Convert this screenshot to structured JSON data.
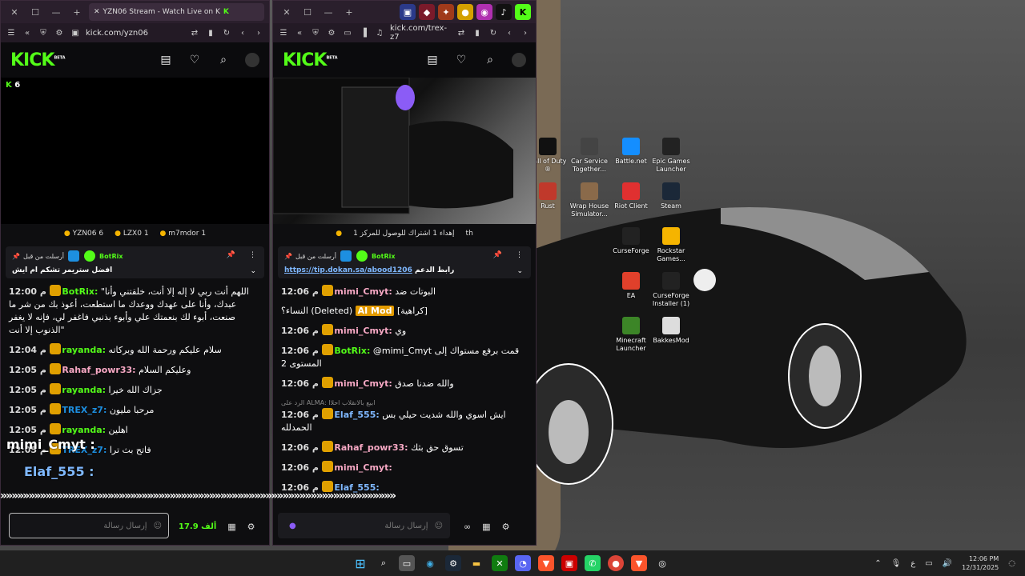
{
  "window1": {
    "tab_title": "YZN06 Stream - Watch Live on K",
    "url": "kick.com/yzn06",
    "viewer_count": "6",
    "gifters": [
      {
        "name": "YZN06",
        "count": "6"
      },
      {
        "name": "LZX0",
        "count": "1"
      },
      {
        "name": "m7mdor",
        "count": "1"
      }
    ],
    "pinned": {
      "sent_label": "أرسلت من قبل",
      "author": "BotRix",
      "text": "افضل ستريمر تشكم ام ايش"
    },
    "messages": [
      {
        "time": "12:00 م",
        "user": "BotRix",
        "user_color": "#53fc18",
        "text": "اللهم أنت ربي لا إله إلا أنت، خلقتني وأنا\" عبدك، وأنا على عهدك ووعدك ما استطعت، أعوذ بك من شر ما صنعت، أبوء لك بنعمتك علي وأبوء بذنبي فاغفر لي، فإنه لا يغفر الذنوب إلا أنت\""
      },
      {
        "time": "12:04 م",
        "user": "rayanda",
        "user_color": "#53fc18",
        "text": "سلام عليكم ورحمة الله وبركاته"
      },
      {
        "time": "12:05 م",
        "user": "Rahaf_powr33",
        "user_color": "#f7a8c4",
        "text": "وعليكم السلام"
      },
      {
        "time": "12:05 م",
        "user": "rayanda",
        "user_color": "#53fc18",
        "text": "جزاك الله خيرا"
      },
      {
        "time": "12:05 م",
        "user": "TREX_z7",
        "user_color": "#1d8fe0",
        "text": "مرحبا مليون"
      },
      {
        "time": "12:05 م",
        "user": "rayanda",
        "user_color": "#53fc18",
        "text": "اهلين"
      },
      {
        "time": "12:05 م",
        "user": "TREX_z7",
        "user_color": "#1d8fe0",
        "text": "فاتح بث ترا"
      }
    ],
    "input_placeholder": "إرسال رسالة",
    "points": "17.9 ألف"
  },
  "window2": {
    "url": "kick.com/trex-z7",
    "goal_text": "إهداء 1 اشتراك للوصول للمركز 1",
    "goal_suffix": "th",
    "pinned": {
      "sent_label": "أرسلت من قبل",
      "author": "BotRix",
      "link": "https://tip.dokan.sa/abood1206",
      "link_label": "رابط الدعم"
    },
    "messages": [
      {
        "time": "12:06 م",
        "user": "mimi_Cmyt",
        "user_color": "#f7a8c4",
        "text": "البوتات ضد"
      },
      {
        "time": "",
        "user": "",
        "user_color": "#fff",
        "text": "النساء؟ (Deleted)",
        "aimod": "AI Mod",
        "tag": "[كراهية]"
      },
      {
        "time": "12:06 م",
        "user": "mimi_Cmyt",
        "user_color": "#f7a8c4",
        "text": "وي"
      },
      {
        "time": "12:06 م",
        "user": "BotRix",
        "user_color": "#53fc18",
        "text": "@mimi_Cmyt قمت برفع مستواك إلى المستوى 2"
      },
      {
        "time": "12:06 م",
        "user": "mimi_Cmyt",
        "user_color": "#f7a8c4",
        "text": "والله ضدنا صدق"
      },
      {
        "time": "12:06 م",
        "user": "Elaf_555",
        "user_color": "#7fb8ff",
        "text": "ايش اسوي والله شديت حيلي بس الحمدلله",
        "reply": "الرد على ALMA: ابيع بالانقلاب احلاا"
      },
      {
        "time": "12:06 م",
        "user": "Rahaf_powr33",
        "user_color": "#f7a8c4",
        "text": "تسوق حق بثك"
      },
      {
        "time": "12:06 م",
        "user": "mimi_Cmyt",
        "user_color": "#f7a8c4",
        "text": ""
      },
      {
        "time": "12:06 م",
        "user": "Elaf_555",
        "user_color": "#7fb8ff",
        "text": ""
      }
    ],
    "input_placeholder": "إرسال رسالة"
  },
  "overlay": {
    "user1": "mimi_Cmyt :",
    "user2": "Elaf_555 :",
    "arrows": "»»»»»»»»»»»»»»»»»»»»»»»»»»»»»»»»»»»»»»»»»»»»»»»»»»»»»»»»»»»»»»»»»»»»»»"
  },
  "desktop_icons": [
    {
      "label": "Call of Duty ®",
      "color": "#111"
    },
    {
      "label": "Car Service Together...",
      "color": "#444"
    },
    {
      "label": "Battle.net",
      "color": "#148eff"
    },
    {
      "label": "Epic Games Launcher",
      "color": "#222"
    },
    {
      "label": "Rust",
      "color": "#c0392b"
    },
    {
      "label": "Wrap House Simulator...",
      "color": "#8a6a4a"
    },
    {
      "label": "Riot Client",
      "color": "#e03030"
    },
    {
      "label": "Steam",
      "color": "#1b2838"
    },
    {
      "label": "CurseForge",
      "color": "#222"
    },
    {
      "label": "Rockstar Games...",
      "color": "#f5b400"
    },
    {
      "label": "EA",
      "color": "#e0402b"
    },
    {
      "label": "CurseForge Installer (1)",
      "color": "#222"
    },
    {
      "label": "Minecraft Launcher",
      "color": "#3c8527"
    },
    {
      "label": "BakkesMod",
      "color": "#ddd"
    }
  ],
  "taskbar": {
    "time": "12:06 PM",
    "date": "12/31/2025",
    "lang": "ع"
  }
}
